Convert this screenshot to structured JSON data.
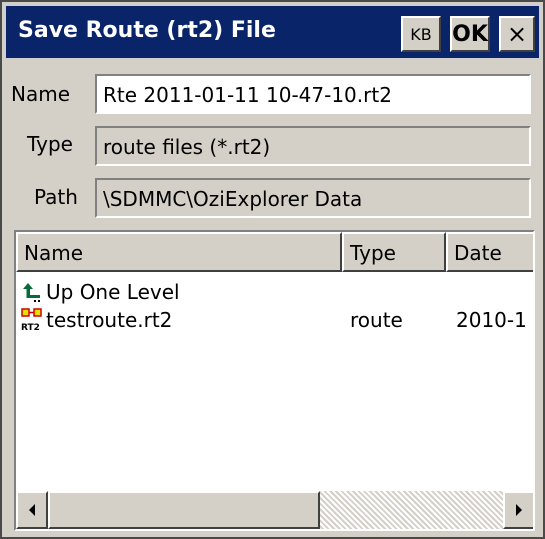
{
  "window": {
    "title": "Save Route (rt2) File",
    "kb_label": "KB",
    "ok_label": "OK",
    "close_label": "×"
  },
  "fields": {
    "name_label": "Name",
    "name_value": "Rte 2011-01-11 10-47-10.rt2",
    "type_label": "Type",
    "type_value": "route files (*.rt2)",
    "path_label": "Path",
    "path_value": "\\SDMMC\\OziExplorer Data"
  },
  "list": {
    "columns": [
      "Name",
      "Type",
      "Date"
    ],
    "rows": [
      {
        "icon": "up-level-icon",
        "name": "Up One Level",
        "type": "",
        "date": ""
      },
      {
        "icon": "rt2-file-icon",
        "name": "testroute.rt2",
        "type": "route",
        "date": "2010-1"
      }
    ]
  },
  "colors": {
    "title_bar": "#0a246a",
    "dialog_face": "#d4d0c8"
  }
}
